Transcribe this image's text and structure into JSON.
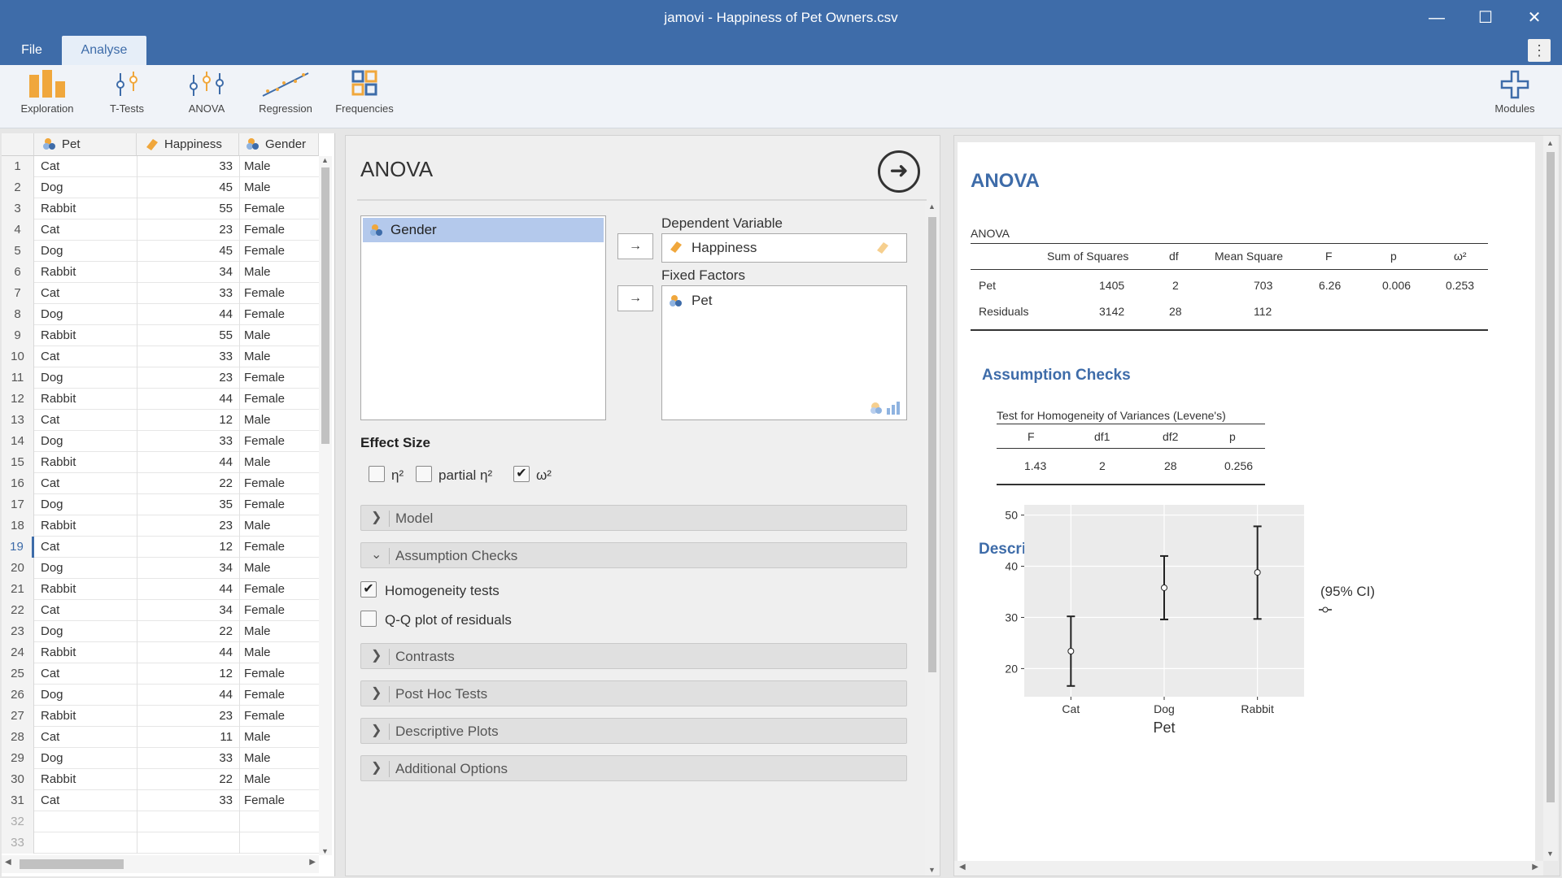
{
  "window": {
    "title": "jamovi - Happiness of Pet Owners.csv"
  },
  "menu": {
    "file": "File",
    "analyse": "Analyse",
    "more_icon": "kebab-icon"
  },
  "ribbon": {
    "exploration": "Exploration",
    "ttests": "T-Tests",
    "anova": "ANOVA",
    "regression": "Regression",
    "frequencies": "Frequencies",
    "modules": "Modules"
  },
  "colors": {
    "accent": "#3e6ca9",
    "ribbon_icon": "#f0a73c",
    "selection": "#b4c9ec"
  },
  "data": {
    "columns": [
      "Pet",
      "Happiness",
      "Gender"
    ],
    "rows": [
      [
        "Cat",
        "33",
        "Male"
      ],
      [
        "Dog",
        "45",
        "Male"
      ],
      [
        "Rabbit",
        "55",
        "Female"
      ],
      [
        "Cat",
        "23",
        "Female"
      ],
      [
        "Dog",
        "45",
        "Female"
      ],
      [
        "Rabbit",
        "34",
        "Male"
      ],
      [
        "Cat",
        "33",
        "Female"
      ],
      [
        "Dog",
        "44",
        "Female"
      ],
      [
        "Rabbit",
        "55",
        "Male"
      ],
      [
        "Cat",
        "33",
        "Male"
      ],
      [
        "Dog",
        "23",
        "Female"
      ],
      [
        "Rabbit",
        "44",
        "Female"
      ],
      [
        "Cat",
        "12",
        "Male"
      ],
      [
        "Dog",
        "33",
        "Female"
      ],
      [
        "Rabbit",
        "44",
        "Male"
      ],
      [
        "Cat",
        "22",
        "Female"
      ],
      [
        "Dog",
        "35",
        "Female"
      ],
      [
        "Rabbit",
        "23",
        "Male"
      ],
      [
        "Cat",
        "12",
        "Female"
      ],
      [
        "Dog",
        "34",
        "Male"
      ],
      [
        "Rabbit",
        "44",
        "Female"
      ],
      [
        "Cat",
        "34",
        "Female"
      ],
      [
        "Dog",
        "22",
        "Male"
      ],
      [
        "Rabbit",
        "44",
        "Male"
      ],
      [
        "Cat",
        "12",
        "Female"
      ],
      [
        "Dog",
        "44",
        "Female"
      ],
      [
        "Rabbit",
        "23",
        "Female"
      ],
      [
        "Cat",
        "11",
        "Male"
      ],
      [
        "Dog",
        "33",
        "Male"
      ],
      [
        "Rabbit",
        "22",
        "Male"
      ],
      [
        "Cat",
        "33",
        "Female"
      ]
    ],
    "empty_rows": [
      "32",
      "33"
    ],
    "selected_row": 19
  },
  "options": {
    "title": "ANOVA",
    "available_vars": [
      "Gender"
    ],
    "dependent_label": "Dependent Variable",
    "dependent_value": "Happiness",
    "fixed_label": "Fixed Factors",
    "fixed_factors": [
      "Pet"
    ],
    "effect_size_label": "Effect Size",
    "eta_label": "η²",
    "partial_eta_label": "partial η²",
    "omega_label": "ω²",
    "eta_checked": false,
    "partial_eta_checked": false,
    "omega_checked": true,
    "sections": {
      "model": "Model",
      "assumption": "Assumption Checks",
      "contrasts": "Contrasts",
      "posthoc": "Post Hoc Tests",
      "descplots": "Descriptive Plots",
      "additional": "Additional Options"
    },
    "homogeneity_label": "Homogeneity tests",
    "homogeneity_checked": true,
    "qq_label": "Q-Q plot of residuals",
    "qq_checked": false
  },
  "results": {
    "title": "ANOVA",
    "anova_caption": "ANOVA",
    "anova_headers": [
      "Sum of Squares",
      "df",
      "Mean Square",
      "F",
      "p",
      "ω²"
    ],
    "anova_rows": [
      {
        "term": "Pet",
        "ss": "1405",
        "df": "2",
        "ms": "703",
        "f": "6.26",
        "p": "0.006",
        "omega": "0.253"
      },
      {
        "term": "Residuals",
        "ss": "3142",
        "df": "28",
        "ms": "112",
        "f": "",
        "p": "",
        "omega": ""
      }
    ],
    "assumption_title": "Assumption Checks",
    "levene_caption": "Test for Homogeneity of Variances (Levene's)",
    "levene_headers": [
      "F",
      "df1",
      "df2",
      "p"
    ],
    "levene_row": [
      "1.43",
      "2",
      "28",
      "0.256"
    ],
    "plot_title": "Descriptive Plot"
  },
  "chart_data": {
    "type": "scatter",
    "xlabel": "Pet",
    "ylabel": "",
    "categories": [
      "Cat",
      "Dog",
      "Rabbit"
    ],
    "means": [
      23.4,
      35.8,
      38.8
    ],
    "ci_lower": [
      16.6,
      29.6,
      29.7
    ],
    "ci_upper": [
      30.2,
      42.0,
      47.8
    ],
    "y_ticks": [
      20,
      30,
      40,
      50
    ],
    "ylim": [
      14.5,
      52
    ],
    "legend": "(95% CI)",
    "grid": true,
    "legend_position": "right"
  }
}
